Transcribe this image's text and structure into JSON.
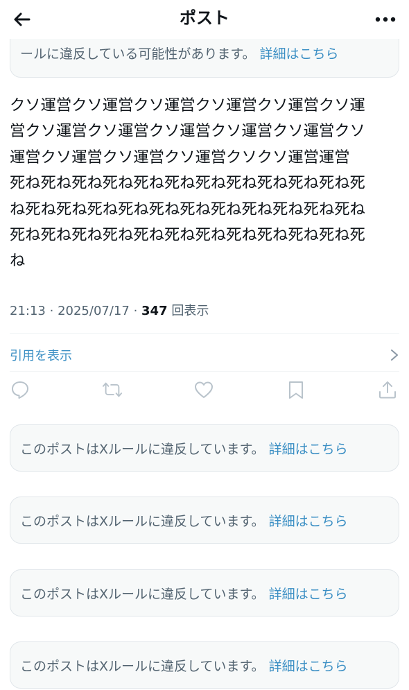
{
  "header": {
    "title": "ポスト"
  },
  "top_notice": {
    "text": "ールに違反している可能性があります。",
    "link": "詳細はこちら"
  },
  "post": {
    "body": "クソ運営クソ運営クソ運営クソ運営クソ運営クソ運\n営クソ運営クソ運営クソ運営クソ運営クソ運営クソ\n運営クソ運営クソ運営クソ運営クソクソ運営運営\n死ね死ね死ね死ね死ね死ね死ね死ね死ね死ね死ね死\nね死ね死ね死ね死ね死ね死ね死ね死ね死ね死ね死ね\n死ね死ね死ね死ね死ね死ね死ね死ね死ね死ね死ね死\nね",
    "time": "21:13",
    "date": "2025/07/17",
    "views_count": "347",
    "views_label": "回表示",
    "separator": "·"
  },
  "quotes": {
    "label": "引用を表示"
  },
  "actions": [
    "reply-icon",
    "repost-icon",
    "like-icon",
    "bookmark-icon",
    "share-icon"
  ],
  "notices": [
    {
      "text": "このポストはXルールに違反しています。",
      "link": "詳細はこちら"
    },
    {
      "text": "このポストはXルールに違反しています。",
      "link": "詳細はこちら"
    },
    {
      "text": "このポストはXルールに違反しています。",
      "link": "詳細はこちら"
    },
    {
      "text": "このポストはXルールに違反しています。",
      "link": "詳細はこちら"
    }
  ],
  "colors": {
    "text": "#0f1419",
    "secondary": "#536471",
    "link": "#3b8fc4",
    "notice_bg": "#f7f9f9",
    "border": "#e1e6ea"
  }
}
